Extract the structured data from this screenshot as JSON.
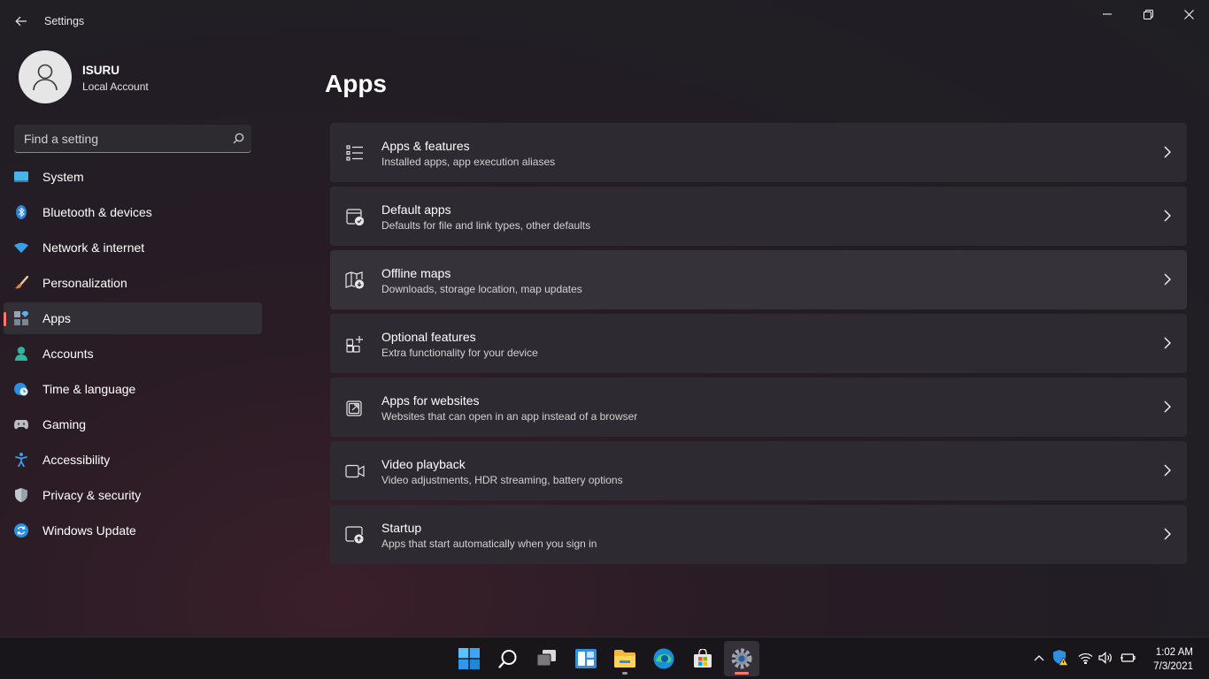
{
  "window": {
    "title": "Settings"
  },
  "profile": {
    "name": "ISURU",
    "account_type": "Local Account"
  },
  "search": {
    "placeholder": "Find a setting"
  },
  "nav": {
    "items": [
      {
        "label": "System",
        "icon": "system-icon"
      },
      {
        "label": "Bluetooth & devices",
        "icon": "bluetooth-icon"
      },
      {
        "label": "Network & internet",
        "icon": "wifi-icon"
      },
      {
        "label": "Personalization",
        "icon": "brush-icon"
      },
      {
        "label": "Apps",
        "icon": "apps-icon",
        "selected": true
      },
      {
        "label": "Accounts",
        "icon": "account-icon"
      },
      {
        "label": "Time & language",
        "icon": "globe-clock-icon"
      },
      {
        "label": "Gaming",
        "icon": "gamepad-icon"
      },
      {
        "label": "Accessibility",
        "icon": "accessibility-icon"
      },
      {
        "label": "Privacy & security",
        "icon": "shield-icon"
      },
      {
        "label": "Windows Update",
        "icon": "update-icon"
      }
    ]
  },
  "main": {
    "title": "Apps",
    "cards": [
      {
        "title": "Apps & features",
        "subtitle": "Installed apps, app execution aliases",
        "icon": "list-icon"
      },
      {
        "title": "Default apps",
        "subtitle": "Defaults for file and link types, other defaults",
        "icon": "default-apps-icon"
      },
      {
        "title": "Offline maps",
        "subtitle": "Downloads, storage location, map updates",
        "icon": "map-icon"
      },
      {
        "title": "Optional features",
        "subtitle": "Extra functionality for your device",
        "icon": "add-features-icon"
      },
      {
        "title": "Apps for websites",
        "subtitle": "Websites that can open in an app instead of a browser",
        "icon": "open-external-icon"
      },
      {
        "title": "Video playback",
        "subtitle": "Video adjustments, HDR streaming, battery options",
        "icon": "video-icon"
      },
      {
        "title": "Startup",
        "subtitle": "Apps that start automatically when you sign in",
        "icon": "startup-icon"
      }
    ]
  },
  "taskbar": {
    "apps": [
      "start-icon",
      "search-icon",
      "task-view-icon",
      "widgets-icon",
      "file-explorer-icon",
      "edge-icon",
      "store-icon",
      "settings-icon"
    ],
    "clock": {
      "time": "1:02 AM",
      "date": "7/3/2021"
    }
  },
  "colors": {
    "accent": "#ff7a6e",
    "background": "#202020",
    "card": "#2d2a31"
  }
}
